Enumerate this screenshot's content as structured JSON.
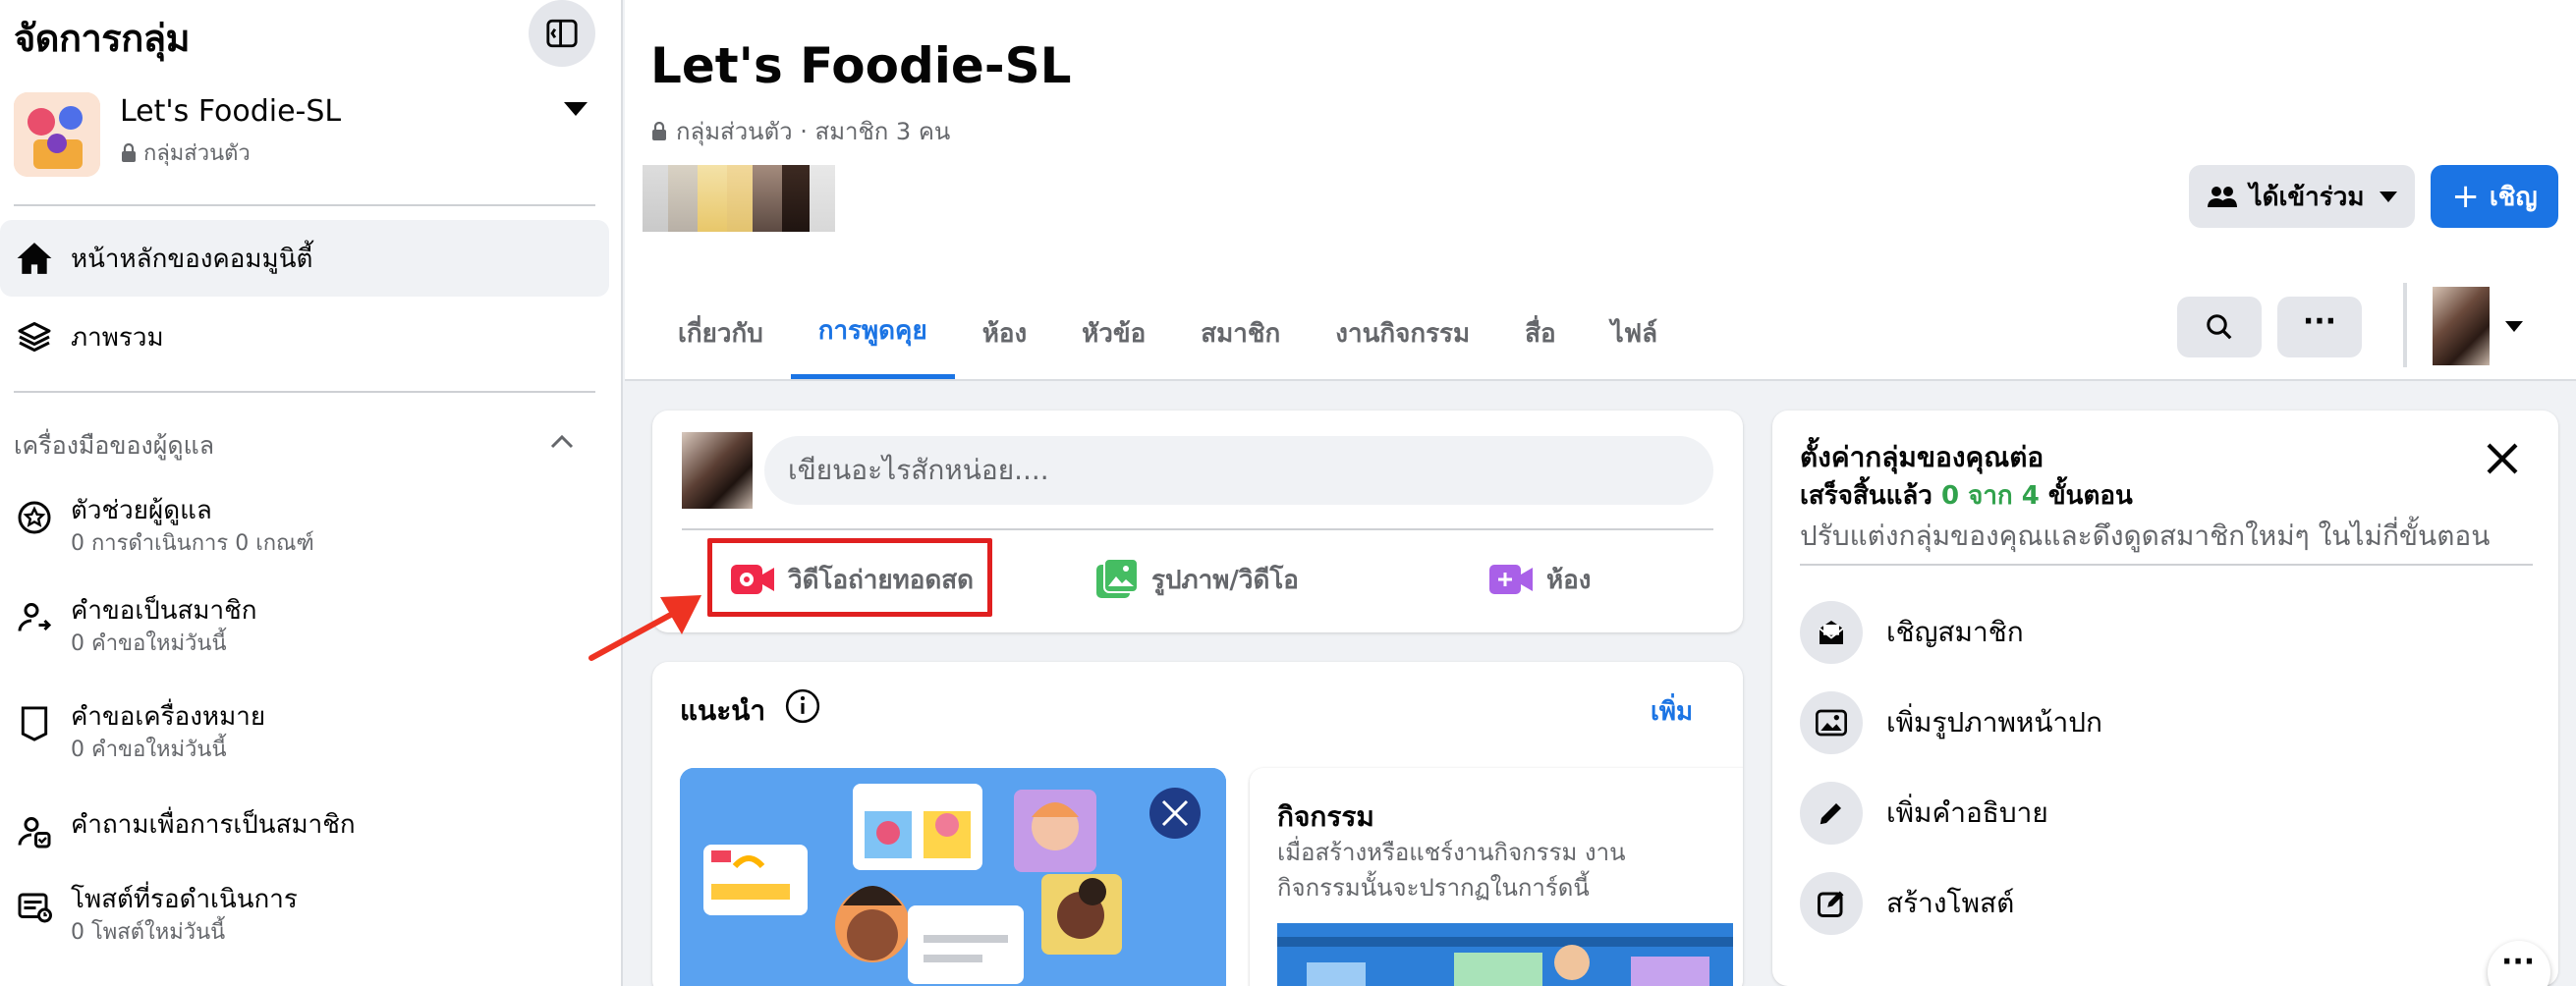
{
  "sidebar": {
    "title": "จัดการกลุ่ม",
    "group": {
      "name": "Let's Foodie-SL",
      "privacy": "กลุ่มส่วนตัว"
    },
    "nav": [
      {
        "label": "หน้าหลักของคอมมูนิตี้",
        "icon": "home-icon",
        "active": true
      },
      {
        "label": "ภาพรวม",
        "icon": "layers-icon",
        "active": false
      }
    ],
    "admin_tools_heading": "เครื่องมือของผู้ดูแล",
    "tools": [
      {
        "title": "ตัวช่วยผู้ดูแล",
        "subtitle": "0 การดำเนินการ 0 เกณฑ์",
        "icon": "admin-assist-icon"
      },
      {
        "title": "คำขอเป็นสมาชิก",
        "subtitle": "0 คำขอใหม่วันนี้",
        "icon": "member-request-icon"
      },
      {
        "title": "คำขอเครื่องหมาย",
        "subtitle": "0 คำขอใหม่วันนี้",
        "icon": "badge-icon"
      },
      {
        "title": "คำถามเพื่อการเป็นสมาชิก",
        "subtitle": "",
        "icon": "question-icon"
      },
      {
        "title": "โพสต์ที่รอดำเนินการ",
        "subtitle": "0 โพสต์ใหม่วันนี้",
        "icon": "pending-posts-icon"
      }
    ]
  },
  "header": {
    "title": "Let's Foodie-SL",
    "subtitle": "กลุ่มส่วนตัว · สมาชิก 3 คน",
    "joined_label": "ได้เข้าร่วม",
    "invite_label": "เชิญ",
    "tabs": [
      {
        "label": "เกี่ยวกับ",
        "active": false
      },
      {
        "label": "การพูดคุย",
        "active": true
      },
      {
        "label": "ห้อง",
        "active": false
      },
      {
        "label": "หัวข้อ",
        "active": false
      },
      {
        "label": "สมาชิก",
        "active": false
      },
      {
        "label": "งานกิจกรรม",
        "active": false
      },
      {
        "label": "สื่อ",
        "active": false
      },
      {
        "label": "ไฟล์",
        "active": false
      }
    ]
  },
  "composer": {
    "placeholder": "เขียนอะไรสักหน่อย....",
    "actions": [
      {
        "label": "วิดีโอถ่ายทอดสด",
        "icon": "live-video-icon",
        "color": "#f02849"
      },
      {
        "label": "รูปภาพ/วิดีโอ",
        "icon": "photo-icon",
        "color": "#45bd62"
      },
      {
        "label": "ห้อง",
        "icon": "room-icon",
        "color": "#a960e8"
      }
    ]
  },
  "suggestions": {
    "title": "แนะนำ",
    "more": "เพิ่ม",
    "event_card": {
      "title": "กิจกรรม",
      "desc_line1": "เมื่อสร้างหรือแชร์งานกิจกรรม งาน",
      "desc_line2": "กิจกรรมนั้นจะปรากฏในการ์ดนี้"
    }
  },
  "setup": {
    "title": "ตั้งค่ากลุ่มของคุณต่อ",
    "progress_prefix": "เสร็จสิ้นแล้ว",
    "progress_value": "0 จาก 4",
    "progress_suffix": "ขั้นตอน",
    "description": "ปรับแต่งกลุ่มของคุณและดึงดูดสมาชิกใหม่ๆ ในไม่กี่ขั้นตอน",
    "steps": [
      {
        "label": "เชิญสมาชิก",
        "icon": "invite-icon"
      },
      {
        "label": "เพิ่มรูปภาพหน้าปก",
        "icon": "cover-photo-icon"
      },
      {
        "label": "เพิ่มคำอธิบาย",
        "icon": "pencil-icon"
      },
      {
        "label": "สร้างโพสต์",
        "icon": "create-post-icon"
      }
    ]
  },
  "colors": {
    "accent": "#1b74e4",
    "progress_green": "#31a24c",
    "highlight_box": "#e02020"
  }
}
